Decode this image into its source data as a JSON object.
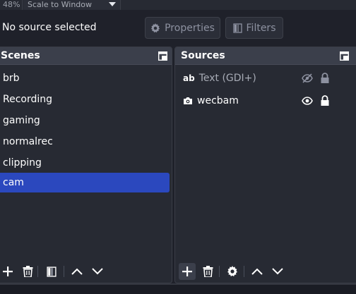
{
  "top": {
    "zoom": "48%",
    "scale_mode": "Scale to Window"
  },
  "context": {
    "no_source": "No source selected",
    "properties_label": "Properties",
    "filters_label": "Filters"
  },
  "scenes": {
    "title": "Scenes",
    "items": [
      {
        "label": "brb"
      },
      {
        "label": "Recording"
      },
      {
        "label": "gaming"
      },
      {
        "label": "normalrec"
      },
      {
        "label": "clipping"
      },
      {
        "label": "cam",
        "selected": true
      }
    ]
  },
  "sources": {
    "title": "Sources",
    "items": [
      {
        "label": "Text (GDI+)",
        "icon": "text-icon",
        "visible": false,
        "locked": true
      },
      {
        "label": "wecbam",
        "icon": "camera-icon",
        "visible": true,
        "locked": true
      }
    ]
  },
  "colors": {
    "background": "#1f212a",
    "panel": "#272a33",
    "header": "#3b3f4b",
    "selection": "#2b48be",
    "text": "#fefefe",
    "muted_text": "#8d91a0"
  }
}
